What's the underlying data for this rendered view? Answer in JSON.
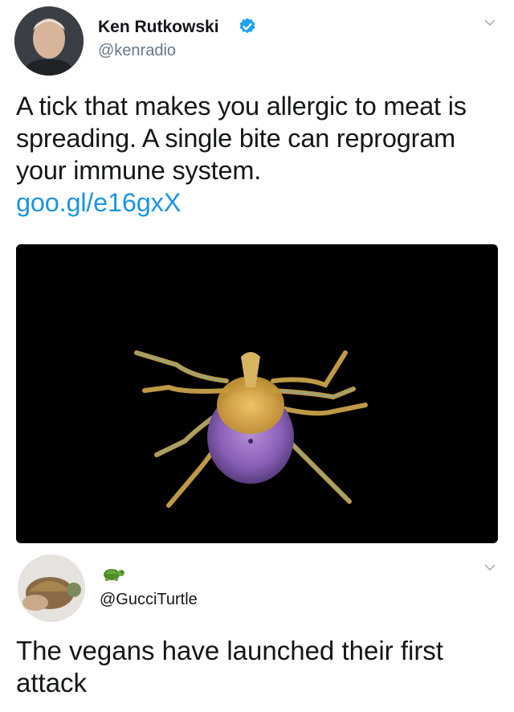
{
  "tweet": {
    "author_name": "Ken Rutkowski",
    "author_handle": "@kenradio",
    "text": "A tick that makes you allergic to meat is spreading. A single bite can reprogram your immune system.",
    "link": "goo.gl/e16gxX",
    "verified": true,
    "media_icon": "tick-image"
  },
  "reply": {
    "author_handle": "@GucciTurtle",
    "name_icon": "turtle-emoji",
    "text": "The vegans have launched their first attack"
  },
  "colors": {
    "link": "#1b95e0",
    "verified_badge": "#1da1f2",
    "secondary_text": "#657786"
  }
}
